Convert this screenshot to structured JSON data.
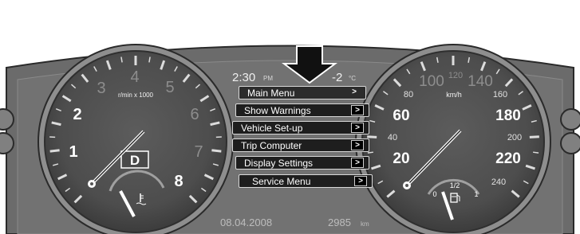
{
  "status": {
    "time": "2:30",
    "time_suffix": "PM",
    "temperature": "-2",
    "temperature_unit": "°C",
    "date": "08.04.2008",
    "odometer": "2985",
    "odometer_unit": "km"
  },
  "tachometer": {
    "unit_label": "r/min x 1000",
    "scale": [
      "1",
      "2",
      "3",
      "4",
      "5",
      "6",
      "7",
      "8"
    ],
    "gear": "D"
  },
  "speedometer": {
    "unit_label": "km/h",
    "scale_major": [
      "20",
      "60",
      "100",
      "140",
      "180",
      "220"
    ],
    "scale_minor": [
      "40",
      "80",
      "120",
      "160",
      "200",
      "240"
    ]
  },
  "fuel_gauge": {
    "labels": [
      "0",
      "1/2",
      "1"
    ]
  },
  "menu": {
    "items": [
      {
        "label": "Main Menu"
      },
      {
        "label": "Show Warnings"
      },
      {
        "label": "Vehicle Set-up"
      },
      {
        "label": "Trip Computer"
      },
      {
        "label": "Display Settings"
      },
      {
        "label": "Service Menu"
      }
    ],
    "chevron": ">"
  },
  "colors": {
    "panel": "#6e6e6e",
    "dial_face": "#555555",
    "menu_bg": "#1e1e1e",
    "text": "#ffffff"
  },
  "icons": [
    "down-arrow-icon",
    "fuel-pump-icon",
    "coolant-temperature-icon",
    "chevron-right-icon"
  ]
}
